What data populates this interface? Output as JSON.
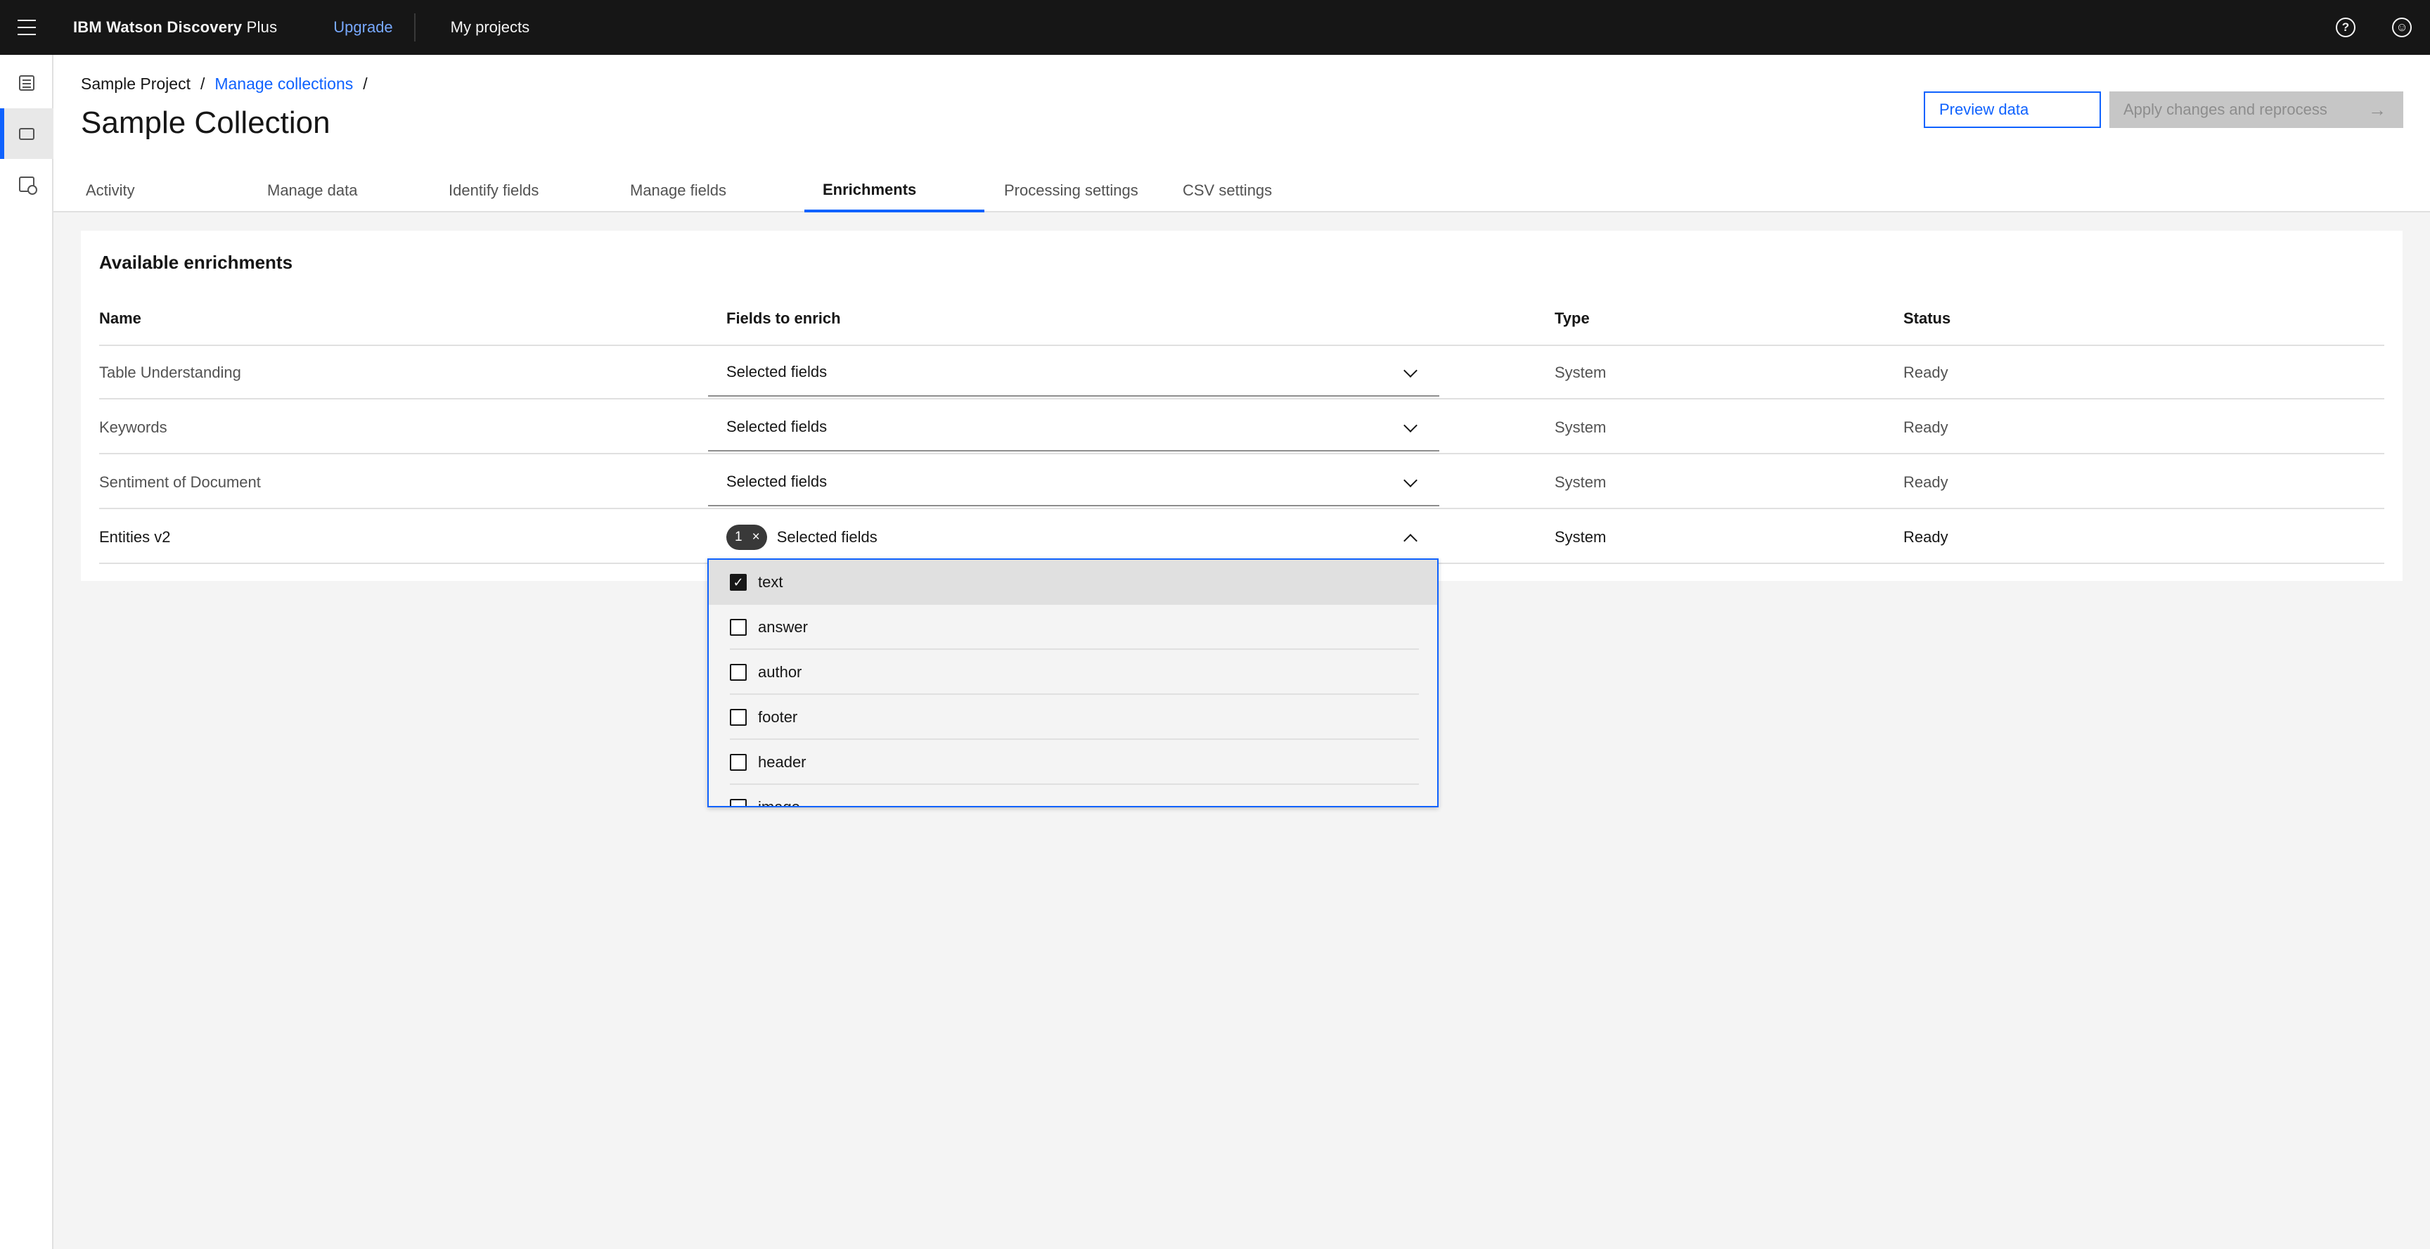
{
  "topbar": {
    "brand_bold": "IBM Watson Discovery",
    "brand_plus": "Plus",
    "upgrade": "Upgrade",
    "my_projects": "My projects",
    "help_glyph": "?",
    "user_glyph": "☺"
  },
  "sidenav": {
    "items": [
      "list-icon",
      "folder-icon",
      "settings-icon"
    ]
  },
  "header": {
    "breadcrumb": {
      "project": "Sample Project",
      "collections": "Manage collections",
      "sep": "/"
    },
    "title": "Sample Collection",
    "preview_button": "Preview data",
    "apply_button": "Apply changes and reprocess",
    "apply_arrow": "→",
    "tabs": [
      "Activity",
      "Manage data",
      "Identify fields",
      "Manage fields",
      "Enrichments",
      "Processing settings",
      "CSV settings"
    ],
    "active_tab": "Enrichments"
  },
  "enrichments": {
    "title": "Available enrichments",
    "columns": {
      "name": "Name",
      "fields": "Fields to enrich",
      "type": "Type",
      "status": "Status"
    },
    "rows": [
      {
        "name": "Table Understanding",
        "fields": "Selected fields",
        "type": "System",
        "status": "Ready"
      },
      {
        "name": "Keywords",
        "fields": "Selected fields",
        "type": "System",
        "status": "Ready"
      },
      {
        "name": "Sentiment of Document",
        "fields": "Selected fields",
        "type": "System",
        "status": "Ready"
      },
      {
        "name": "Entities v2",
        "fields": "Selected fields",
        "type": "System",
        "status": "Ready",
        "tag_count": "1",
        "tag_close": "×"
      }
    ]
  },
  "dropdown": {
    "options": [
      {
        "label": "text",
        "checked": true
      },
      {
        "label": "answer",
        "checked": false
      },
      {
        "label": "author",
        "checked": false
      },
      {
        "label": "footer",
        "checked": false
      },
      {
        "label": "header",
        "checked": false
      },
      {
        "label": "image",
        "checked": false
      }
    ],
    "check_glyph": "✓"
  }
}
